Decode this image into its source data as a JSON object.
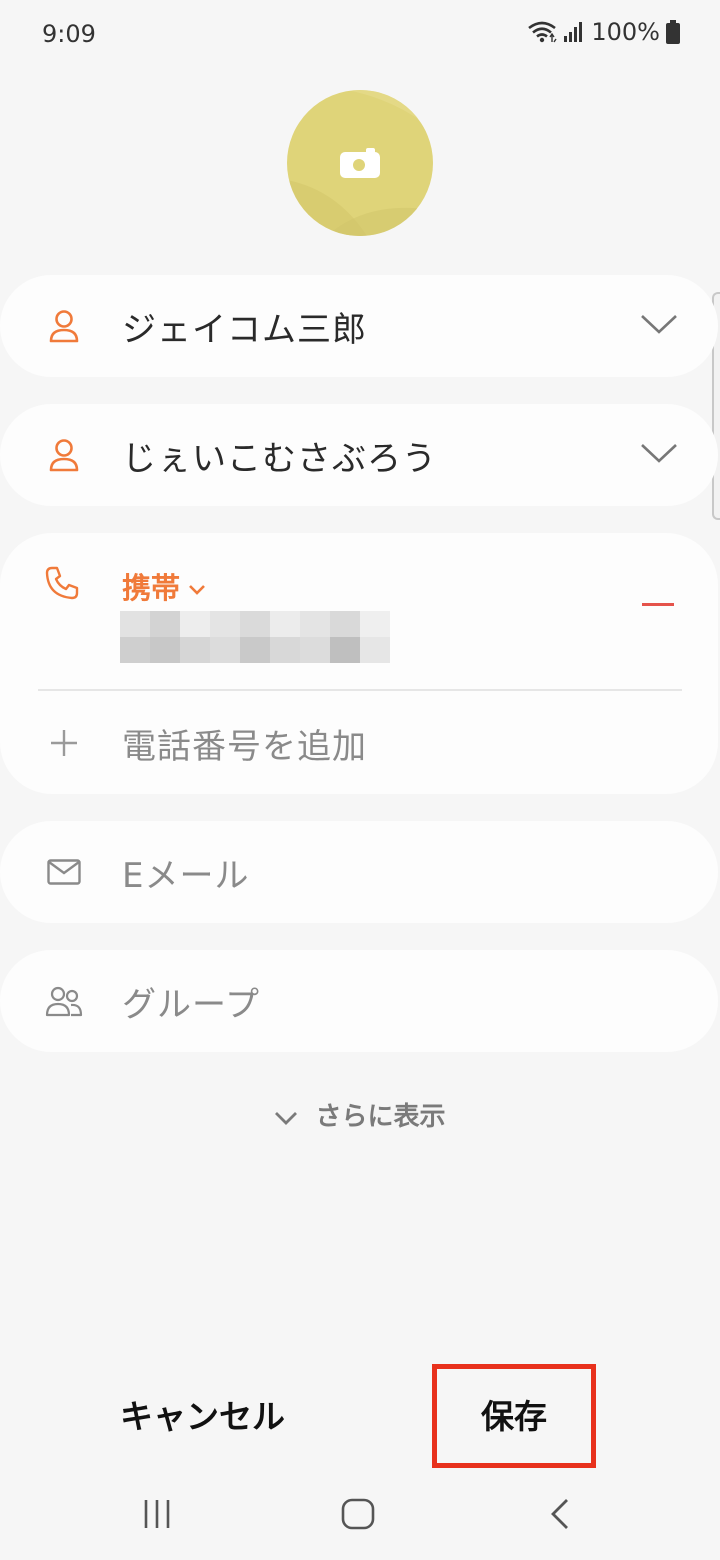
{
  "status": {
    "time": "9:09",
    "battery": "100%"
  },
  "name": {
    "full": "ジェイコム三郎",
    "reading": "じぇいこむさぶろう"
  },
  "phone": {
    "type": "携帯",
    "add_label": "電話番号を追加"
  },
  "email": {
    "placeholder": "Eメール"
  },
  "group": {
    "placeholder": "グループ"
  },
  "more": {
    "label": "さらに表示"
  },
  "actions": {
    "cancel": "キャンセル",
    "save": "保存"
  },
  "colors": {
    "accent": "#f07a3a",
    "avatar": "#dfd479",
    "highlight": "#e8311c",
    "remove": "#e5534b"
  },
  "icons": [
    "wifi-icon",
    "signal-icon",
    "battery-icon",
    "camera-icon",
    "person-icon",
    "chevron-down-icon",
    "phone-icon",
    "plus-icon",
    "mail-icon",
    "group-icon",
    "recents-icon",
    "home-icon",
    "back-icon"
  ]
}
